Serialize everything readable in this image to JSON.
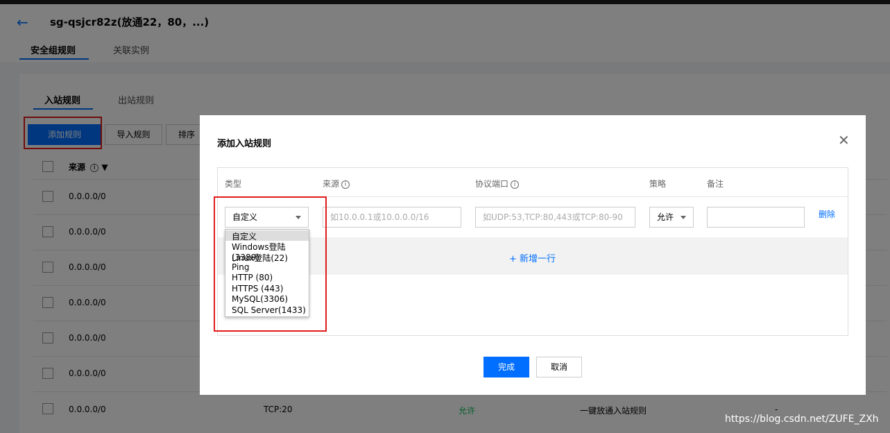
{
  "header": {
    "back_icon": "arrow-left-icon",
    "title": "sg-qsjcr82z(放通22，80，...)",
    "tabs": [
      "安全组规则",
      "关联实例"
    ]
  },
  "rules": {
    "subtabs": [
      "入站规则",
      "出站规则"
    ],
    "toolbar": {
      "add": "添加规则",
      "import": "导入规则",
      "sort": "排序"
    },
    "columns": {
      "source": "来源"
    },
    "rows": [
      {
        "source": "0.0.0.0/0"
      },
      {
        "source": "0.0.0.0/0"
      },
      {
        "source": "0.0.0.0/0"
      },
      {
        "source": "0.0.0.0/0"
      },
      {
        "source": "0.0.0.0/0"
      },
      {
        "source": "0.0.0.0/0"
      },
      {
        "source": "0.0.0.0/0",
        "port": "TCP:20",
        "policy": "允许",
        "note": "一键放通入站规则",
        "extra": "-"
      }
    ]
  },
  "dialog": {
    "title": "添加入站规则",
    "headers": {
      "type": "类型",
      "source": "来源",
      "port": "协议端口",
      "policy": "策略",
      "note": "备注"
    },
    "type_value": "自定义",
    "source_placeholder": "如10.0.0.1或10.0.0.0/16",
    "port_placeholder": "如UDP:53,TCP:80,443或TCP:80-90",
    "policy_value": "允许",
    "delete_label": "删除",
    "add_row_label": "+ 新增一行",
    "type_options": [
      "自定义",
      "Windows登陆(3389)",
      "Linux登陆(22)",
      "Ping",
      "HTTP (80)",
      "HTTPS (443)",
      "MySQL(3306)",
      "SQL Server(1433)"
    ],
    "confirm_label": "完成",
    "cancel_label": "取消"
  },
  "watermark": "https://blog.csdn.net/ZUFE_ZXh",
  "colors": {
    "accent": "#006eff",
    "highlight": "#e01b1b",
    "allow": "#0abf5b"
  }
}
